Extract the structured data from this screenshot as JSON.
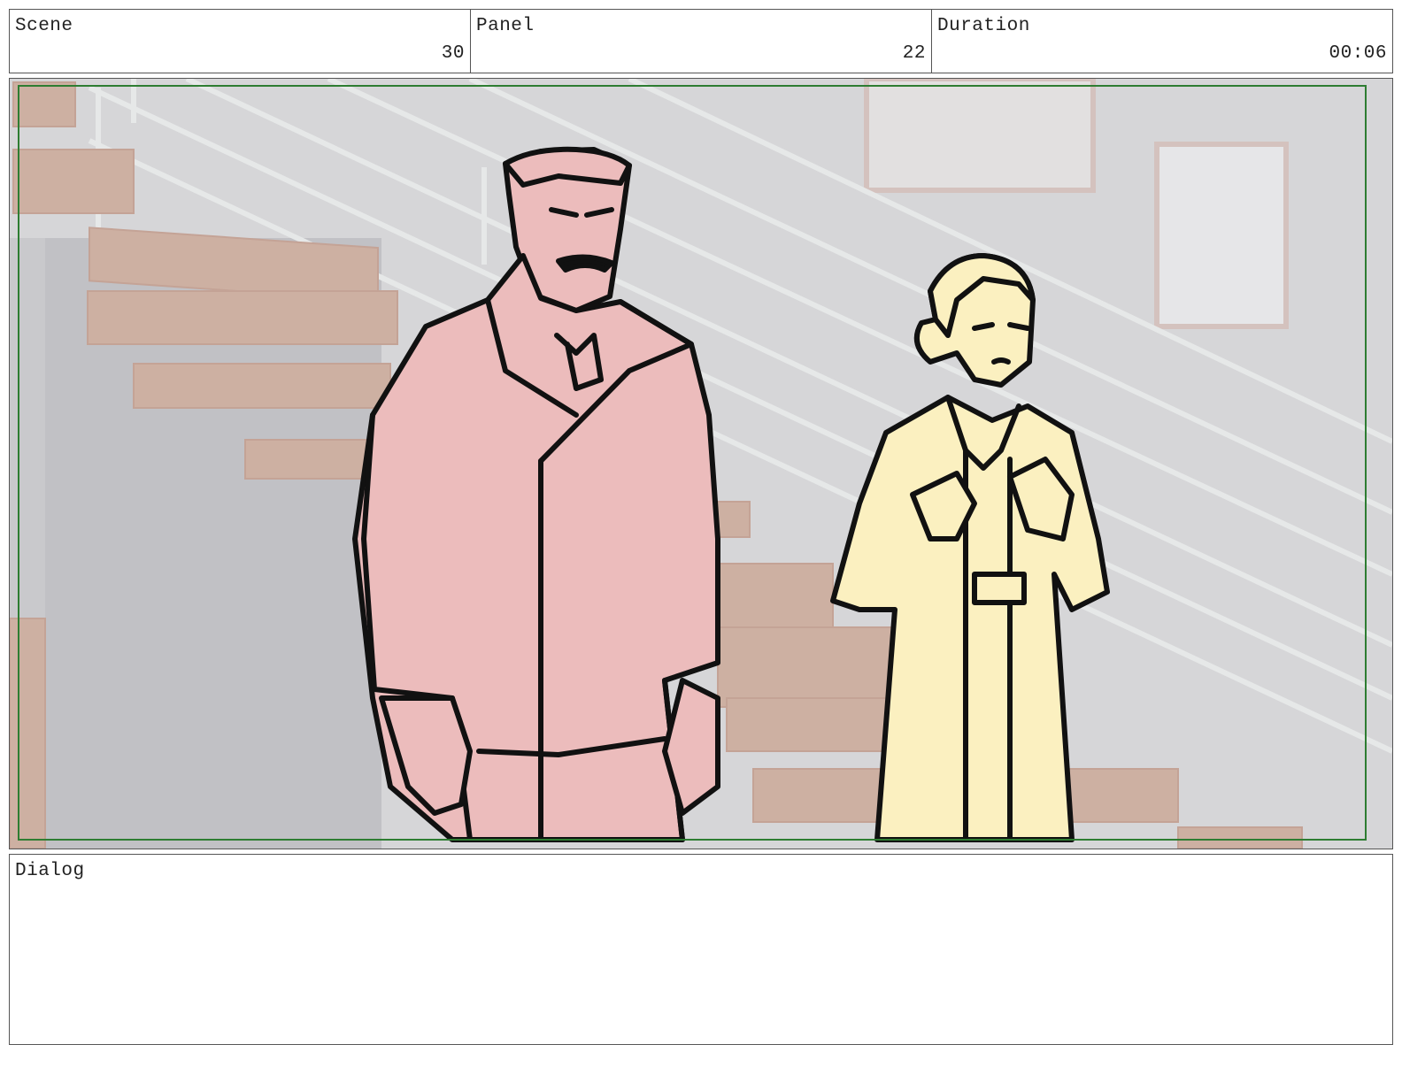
{
  "header": {
    "scene": {
      "label": "Scene",
      "value": "30"
    },
    "panel": {
      "label": "Panel",
      "value": "22"
    },
    "duration": {
      "label": "Duration",
      "value": "00:06"
    }
  },
  "dialog": {
    "label": "Dialog",
    "text": ""
  },
  "colors": {
    "safe_frame": "#2e7d32",
    "man_fill": "#ecbcbc",
    "woman_fill": "#fbf0c0",
    "wall": "#d6d6d8",
    "stair_tread": "#cdb0a2"
  }
}
